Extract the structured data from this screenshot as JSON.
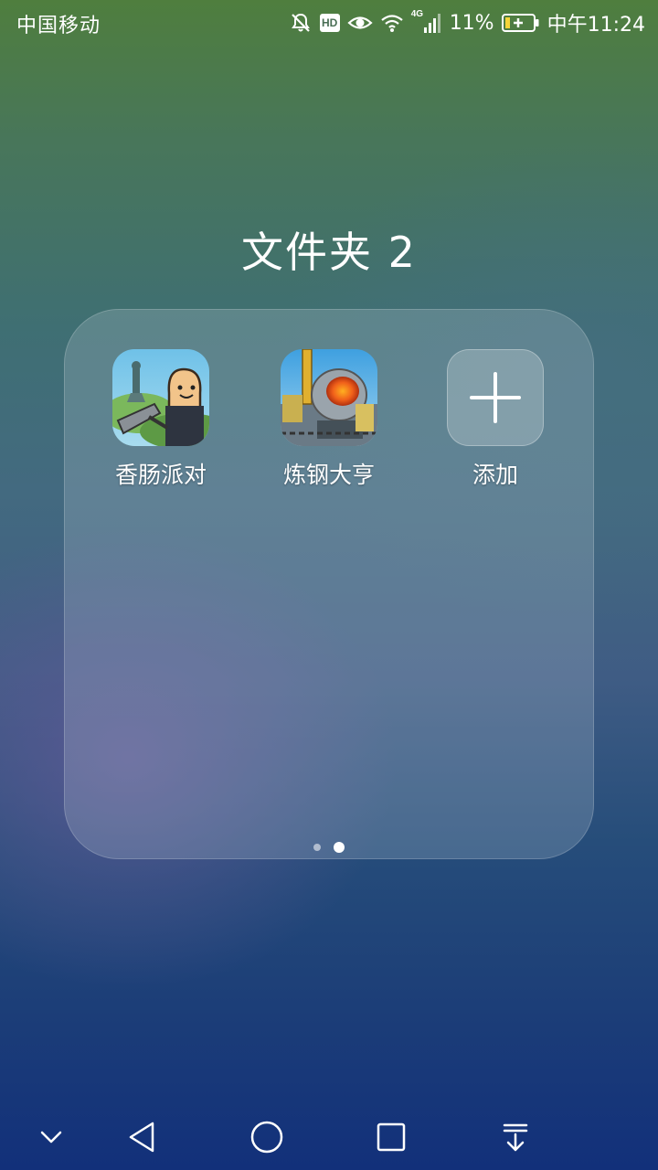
{
  "status_bar": {
    "carrier": "中国移动",
    "network": "4G",
    "battery": "11%",
    "time": "中午11:24",
    "hd_label": "HD",
    "icons": [
      "mute-icon",
      "hd-icon",
      "eye-icon",
      "wifi-icon",
      "signal-icon",
      "battery-charging-icon"
    ]
  },
  "folder": {
    "title": "文件夹 2",
    "apps": [
      {
        "label": "香肠派对",
        "icon": "sausage-party-app-icon"
      },
      {
        "label": "炼钢大亨",
        "icon": "steel-tycoon-app-icon"
      },
      {
        "label": "添加",
        "icon": "plus-icon"
      }
    ],
    "pages": 2,
    "current_page": 2
  },
  "nav_bar": {
    "buttons": [
      "chevron-down-icon",
      "back-icon",
      "home-icon",
      "recents-icon",
      "notification-pull-icon"
    ]
  }
}
